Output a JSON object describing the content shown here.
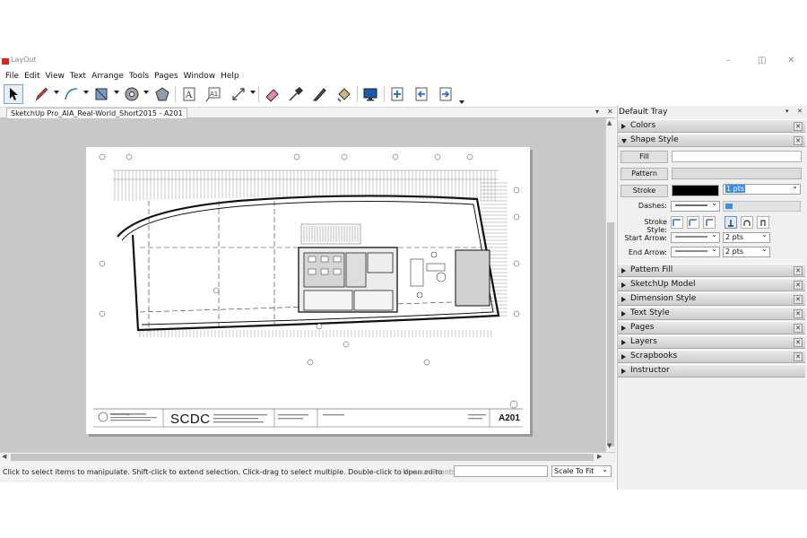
{
  "app": {
    "title": "LayOut"
  },
  "menus": [
    "File",
    "Edit",
    "View",
    "Text",
    "Arrange",
    "Tools",
    "Pages",
    "Window",
    "Help"
  ],
  "document_tab": {
    "label": "SketchUp Pro_AIA_Real-World_Short2015 - A201"
  },
  "sheet": {
    "logo_text": "SCDC",
    "sheet_number": "A201",
    "firm": "Vanden Design"
  },
  "status": {
    "hint": "Click to select items to manipulate. Shift-click to extend selection. Click-drag to select multiple. Double-click to open edito",
    "measurements_label": "Measurements",
    "measurements_value": "",
    "scale": "Scale To Fit"
  },
  "tray": {
    "title": "Default Tray",
    "panels_top": [
      {
        "name": "Colors",
        "open": false
      },
      {
        "name": "Shape Style",
        "open": true
      }
    ],
    "shape_style": {
      "fill_label": "Fill",
      "pattern_label": "Pattern",
      "stroke_label": "Stroke",
      "stroke_width": "1 pts",
      "dashes_label": "Dashes:",
      "stroke_style_label": "Stroke Style:",
      "start_arrow_label": "Start Arrow:",
      "start_arrow_size": "2 pts",
      "end_arrow_label": "End Arrow:",
      "end_arrow_size": "2 pts",
      "stroke_color": "#000000",
      "fill_color": "#ffffff"
    },
    "panels_bottom": [
      {
        "name": "Pattern Fill"
      },
      {
        "name": "SketchUp Model"
      },
      {
        "name": "Dimension Style"
      },
      {
        "name": "Text Style"
      },
      {
        "name": "Pages"
      },
      {
        "name": "Layers"
      },
      {
        "name": "Scrapbooks"
      },
      {
        "name": "Instructor"
      }
    ]
  },
  "colors": {
    "accent": "#d9261c",
    "canvas_bg": "#c8c8c8",
    "selection": "#3a8ee6"
  }
}
